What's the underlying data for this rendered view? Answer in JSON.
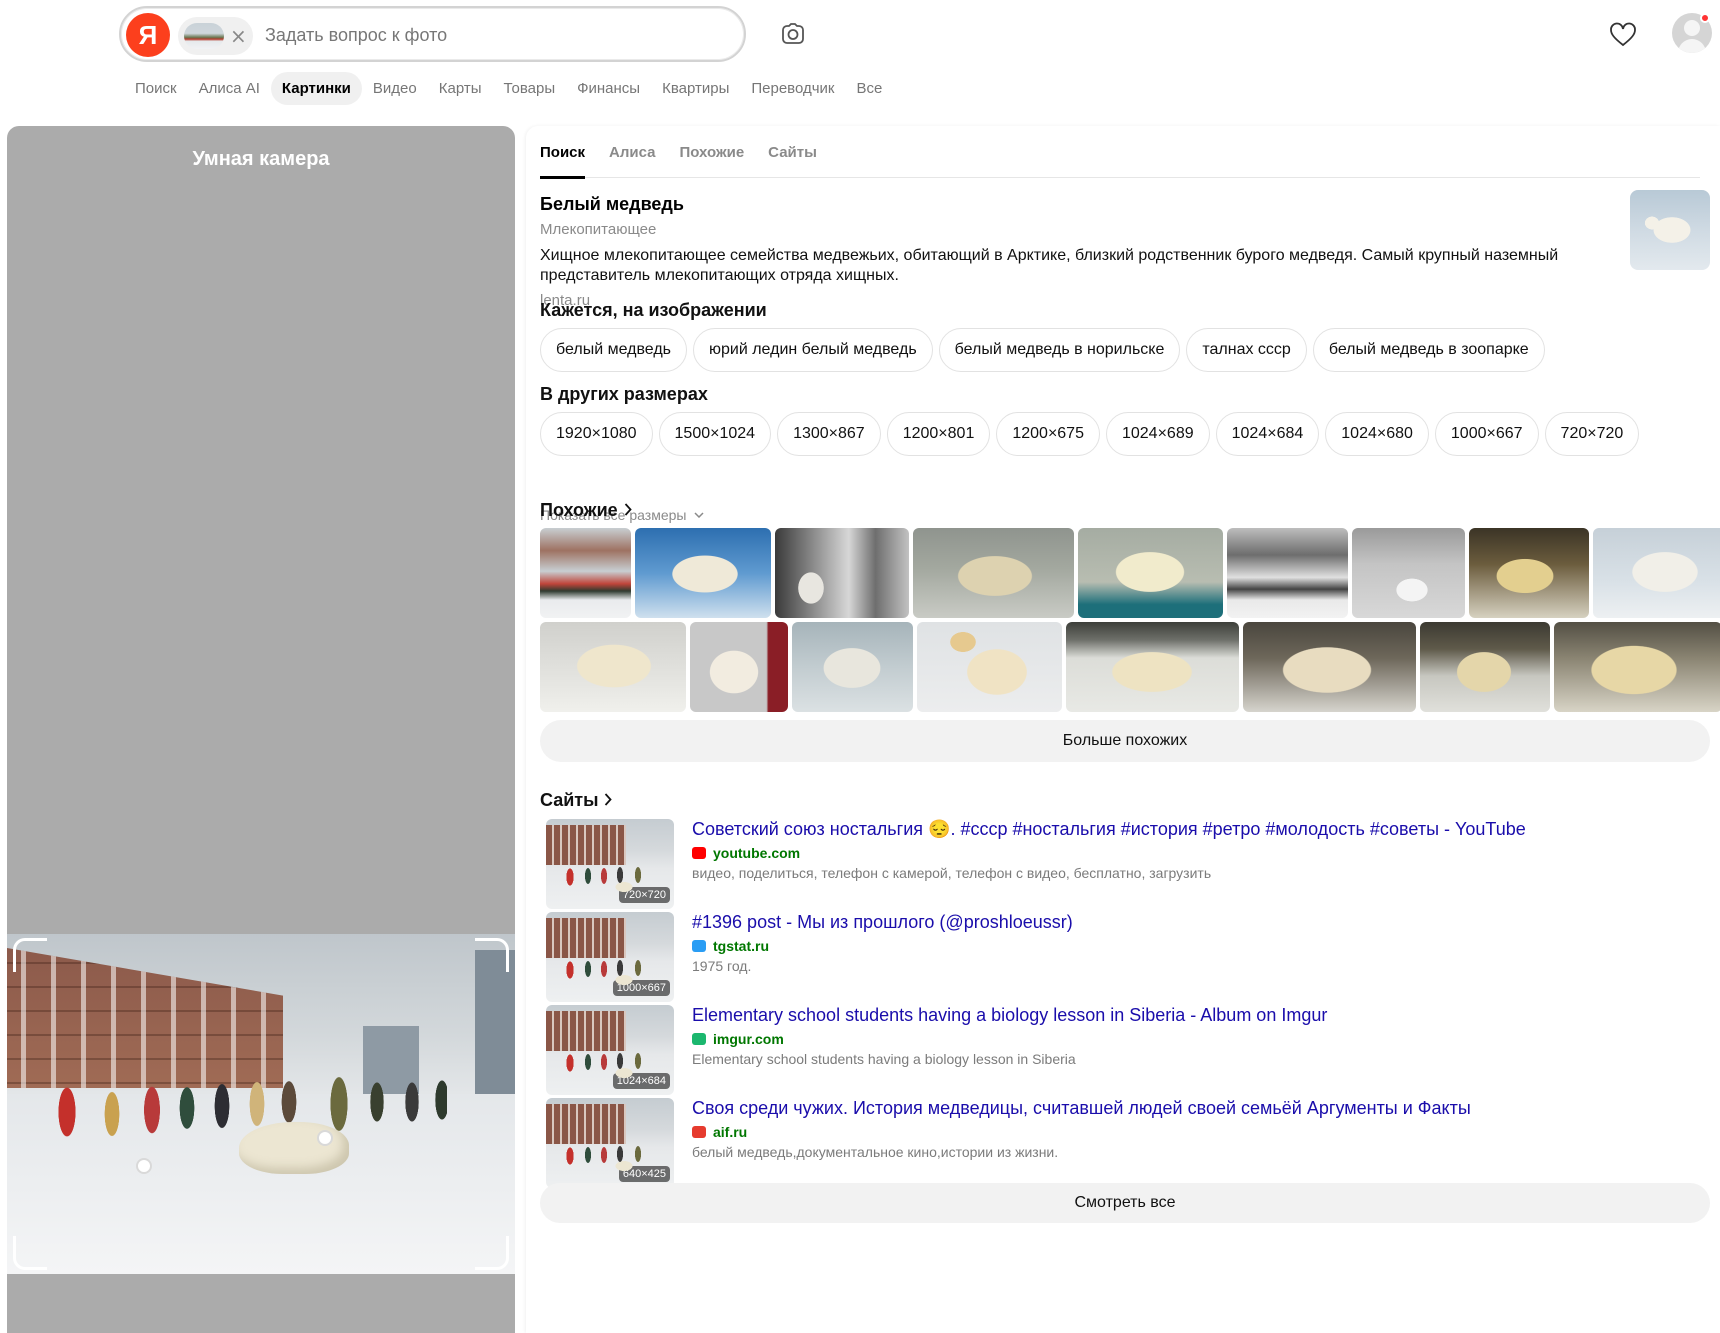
{
  "header": {
    "logo_letter": "Я",
    "search_placeholder": "Задать вопрос к фото",
    "chip_close": "×"
  },
  "nav": {
    "items": [
      "Поиск",
      "Алиса AI",
      "Картинки",
      "Видео",
      "Карты",
      "Товары",
      "Финансы",
      "Квартиры",
      "Переводчик",
      "Все"
    ],
    "active_index": 2
  },
  "left_panel": {
    "title": "Умная камера"
  },
  "tabs": [
    "Поиск",
    "Алиса",
    "Похожие",
    "Сайты"
  ],
  "entity": {
    "title": "Белый медведь",
    "subtitle": "Млекопитающее",
    "description": "Хищное млекопитающее семейства медвежьих, обитающий в Арктике, близкий родственник бурого медведя. Самый крупный наземный представитель млекопитающих отряда хищных.",
    "source": "lenta.ru"
  },
  "seems_section": {
    "title": "Кажется, на изображении",
    "chips": [
      "белый медведь",
      "юрий ледин белый медведь",
      "белый медведь в норильске",
      "талнах ссср",
      "белый медведь в зоопарке"
    ]
  },
  "sizes_section": {
    "title": "В других размерах",
    "chips": [
      "1920×1080",
      "1500×1024",
      "1300×867",
      "1200×801",
      "1200×675",
      "1024×689",
      "1024×684",
      "1024×680",
      "1000×667",
      "720×720"
    ],
    "show_all": "Показать все размеры"
  },
  "similar_section": {
    "title": "Похожие",
    "more_button": "Больше похожих"
  },
  "sites_section": {
    "title": "Сайты",
    "results": [
      {
        "title": "Советский союз ностальгия 😔. #ссср #ностальгия #история #ретро #молодость #советы - YouTube",
        "domain": "youtube.com",
        "snippet": "видео, поделиться, телефон с камерой, телефон с видео, бесплатно, загрузить",
        "size": "720×720",
        "favicon_color": "#ff0000"
      },
      {
        "title": "#1396 post - Мы из прошлого (@proshloeussr)",
        "domain": "tgstat.ru",
        "snippet": "1975 год.",
        "size": "1000×667",
        "favicon_color": "#2a9df4"
      },
      {
        "title": "Elementary school students having a biology lesson in Siberia - Album on Imgur",
        "domain": "imgur.com",
        "snippet": "Elementary school students having a biology lesson in Siberia",
        "size": "1024×684",
        "favicon_color": "#1bb76e"
      },
      {
        "title": "Своя среди чужих. История медведицы, считавшей людей своей семьёй Аргументы и Факты",
        "domain": "aif.ru",
        "snippet": "белый медведь,документальное кино,истории из жизни.",
        "size": "640×425",
        "favicon_color": "#e63b2e"
      }
    ],
    "see_all_button": "Смотреть все"
  },
  "colors": {
    "brand": "#fc3f1d",
    "link": "#1a0dab",
    "domain": "#007700",
    "left_panel_bg": "#ababab"
  }
}
